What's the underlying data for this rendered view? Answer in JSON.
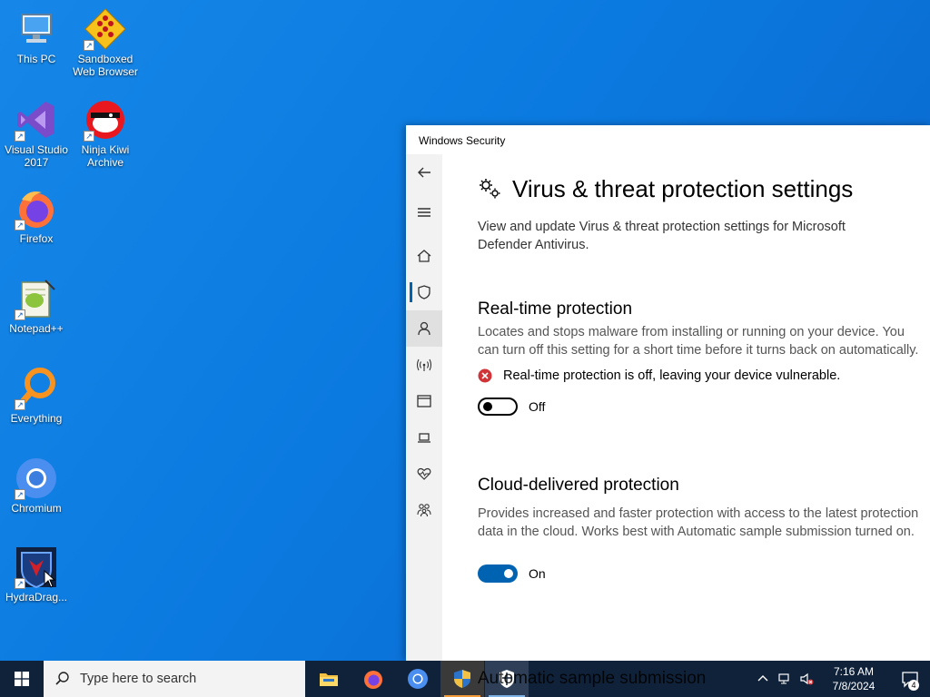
{
  "desktop": {
    "icons": [
      {
        "label": "This PC",
        "icon": "computer-icon"
      },
      {
        "label": "Sandboxed Web Browser",
        "icon": "sandboxie-icon"
      },
      {
        "label": "Visual Studio 2017",
        "icon": "visual-studio-icon"
      },
      {
        "label": "Ninja Kiwi Archive",
        "icon": "ninja-kiwi-icon"
      },
      {
        "label": "Firefox",
        "icon": "firefox-icon"
      },
      {
        "label": "Notepad++",
        "icon": "notepadpp-icon"
      },
      {
        "label": "Everything",
        "icon": "everything-search-icon"
      },
      {
        "label": "Chromium",
        "icon": "chromium-icon"
      },
      {
        "label": "HydraDrag...",
        "icon": "hydradragon-icon"
      }
    ]
  },
  "window": {
    "title": "Windows Security",
    "page": {
      "title": "Virus & threat protection settings",
      "description": "View and update Virus & threat protection settings for Microsoft Defender Antivirus."
    },
    "realtime": {
      "title": "Real-time protection",
      "description": "Locates and stops malware from installing or running on your device. You can turn off this setting for a short time before it turns back on automatically.",
      "warning": "Real-time protection is off, leaving your device vulnerable.",
      "toggle_label": "Off",
      "enabled": false
    },
    "cloud": {
      "title": "Cloud-delivered protection",
      "description": "Provides increased and faster protection with access to the latest protection data in the cloud. Works best with Automatic sample submission turned on.",
      "toggle_label": "On",
      "enabled": true
    },
    "next_section_partial": "Automatic sample submission"
  },
  "taskbar": {
    "search_placeholder": "Type here to search",
    "clock_time": "7:16 AM",
    "clock_date": "7/8/2024",
    "notification_count": "4",
    "colors": {
      "accent": "#0063b1",
      "taskbar": "#10223a",
      "error": "#d13438"
    }
  }
}
